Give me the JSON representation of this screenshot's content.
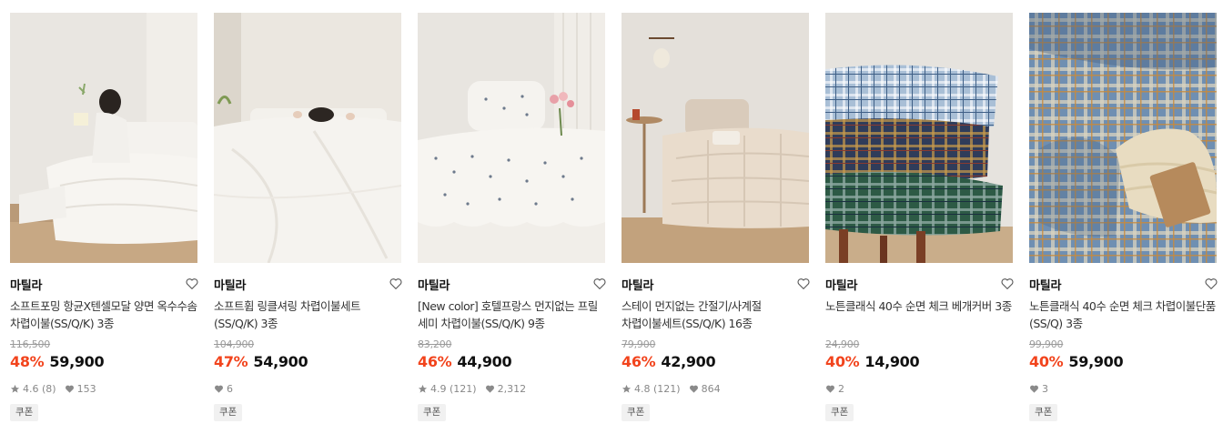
{
  "products": [
    {
      "brand": "마틸라",
      "name": "소프트포밍 항균X텐셀모달 양면 옥수수솜 차렵이불(SS/Q/K) 3종",
      "original_price": "116,500",
      "discount_rate": "48%",
      "price": "59,900",
      "rating": "4.6 (8)",
      "likes": "153",
      "badge": "쿠폰",
      "image": "white-comforter-woman-reading-icon"
    },
    {
      "brand": "마틸라",
      "name": "소프트휩 링클셔링 차렵이불세트(SS/Q/K) 3종",
      "original_price": "104,900",
      "discount_rate": "47%",
      "price": "54,900",
      "rating": "",
      "likes": "6",
      "badge": "쿠폰",
      "image": "white-comforter-person-under-icon"
    },
    {
      "brand": "마틸라",
      "name": "[New color] 호텔프랑스 먼지없는 프릴 세미 차렵이불(SS/Q/K) 9종",
      "original_price": "83,200",
      "discount_rate": "46%",
      "price": "44,900",
      "rating": "4.9 (121)",
      "likes": "2,312",
      "badge": "쿠폰",
      "image": "ruffle-dot-bedding-flowers-icon"
    },
    {
      "brand": "마틸라",
      "name": "스테이 먼지없는 간절기/사계절 차렵이불세트(SS/Q/K) 16종",
      "original_price": "79,900",
      "discount_rate": "46%",
      "price": "42,900",
      "rating": "4.8 (121)",
      "likes": "864",
      "badge": "쿠폰",
      "image": "beige-quilted-comforter-icon"
    },
    {
      "brand": "마틸라",
      "name": "노튼클래식 40수 순면 체크 베개커버 3종",
      "original_price": "24,900",
      "discount_rate": "40%",
      "price": "14,900",
      "rating": "",
      "likes": "2",
      "badge": "쿠폰",
      "image": "plaid-pillows-stack-icon"
    },
    {
      "brand": "마틸라",
      "name": "노튼클래식 40수 순면 체크 차렵이불단품(SS/Q) 3종",
      "original_price": "99,900",
      "discount_rate": "40%",
      "price": "59,900",
      "rating": "",
      "likes": "3",
      "badge": "쿠폰",
      "image": "blue-plaid-bedding-knit-icon"
    }
  ],
  "colors": {
    "discount": "#f2441d",
    "price": "#111111",
    "original": "#9a9a9a",
    "meta": "#888888",
    "badge_bg": "#f1f1f1"
  }
}
